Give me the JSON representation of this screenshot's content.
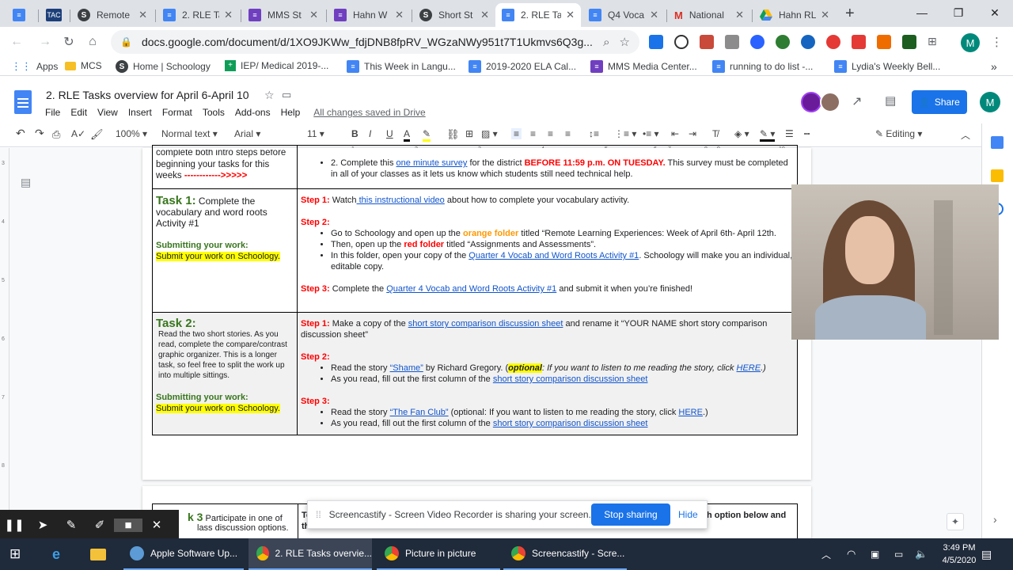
{
  "browser": {
    "tabs": [
      {
        "label": "",
        "icon": "docs-icon"
      },
      {
        "label": "",
        "icon": "tac-icon"
      },
      {
        "label": "Remote",
        "icon": "schoology-icon"
      },
      {
        "label": "2. RLE Ta",
        "icon": "docs-icon"
      },
      {
        "label": "MMS St",
        "icon": "forms-icon"
      },
      {
        "label": "Hahn W",
        "icon": "forms-icon"
      },
      {
        "label": "Short St",
        "icon": "schoology-icon"
      },
      {
        "label": "2. RLE Ta",
        "icon": "docs-icon",
        "active": true
      },
      {
        "label": "Q4 Voca",
        "icon": "docs-icon"
      },
      {
        "label": "National",
        "icon": "gmail-icon"
      },
      {
        "label": "Hahn RL",
        "icon": "drive-icon"
      }
    ],
    "tac_label": "TAC",
    "url": "docs.google.com/document/d/1XO9JKWw_fdjDNB8fpRV_WGzaNWy951t7T1Ukmvs6Q3g...",
    "profile_initial": "M",
    "bookmarks": [
      {
        "label": "Apps"
      },
      {
        "label": "MCS"
      },
      {
        "label": "Home | Schoology"
      },
      {
        "label": "IEP/ Medical 2019-..."
      },
      {
        "label": "This Week in Langu..."
      },
      {
        "label": "2019-2020 ELA Cal..."
      },
      {
        "label": "MMS Media Center..."
      },
      {
        "label": "running to do list -..."
      },
      {
        "label": "Lydia's Weekly Bell..."
      }
    ]
  },
  "docs": {
    "title": "2. RLE Tasks overview for April 6-April 10",
    "menus": [
      "File",
      "Edit",
      "View",
      "Insert",
      "Format",
      "Tools",
      "Add-ons",
      "Help"
    ],
    "saved_status": "All changes saved in Drive",
    "share_label": "Share",
    "toolbar": {
      "zoom": "100%",
      "style": "Normal text",
      "font": "Arial",
      "size": "11",
      "mode": "Editing"
    },
    "ruler_numbers": [
      "1",
      "2",
      "3",
      "4",
      "5",
      "6",
      "7",
      "8",
      "9",
      "10"
    ]
  },
  "content": {
    "row0_left_l1": "complete both intro steps before",
    "row0_left_l2": "beginning your tasks for this",
    "row0_left_l3": "weeks",
    "row0_arrow": "------------>>>>>",
    "row0_right_pre": "2. Complete this ",
    "row0_right_link": "one minute survey",
    "row0_right_mid": " for the district ",
    "row0_right_red": "BEFORE 11:59 p.m. ON TUESDAY.",
    "row0_right_post": "  This survey must be completed in all of your classes as it lets us know which students still need technical help.",
    "task1_title": "Task 1:",
    "task1_desc": " Complete the vocabulary and word roots Activity #1",
    "task1_sub": "Submitting your work:",
    "task1_sub_text": "Submit your work on Schoology.",
    "t1_s1_label": "Step 1:",
    "t1_s1_pre": " Watch",
    "t1_s1_link": " this instructional video",
    "t1_s1_post": " about how to complete your vocabulary activity.",
    "t1_s2_label": "Step 2:",
    "t1_b1_pre": " Go to Schoology and open up the ",
    "t1_b1_orange": "orange folder",
    "t1_b1_post": " titled “Remote Learning Experiences: Week of April 6th- April 12th.",
    "t1_b2_pre": "Then, open up the ",
    "t1_b2_red": "red folder",
    "t1_b2_post": " titled “Assignments and Assessments”.",
    "t1_b3_pre": "In this folder, open your copy of the ",
    "t1_b3_link": "Quarter 4 Vocab and Word Roots Activity #1",
    "t1_b3_post": ". Schoology will make you an individual, editable copy.",
    "t1_s3_label": "Step 3:",
    "t1_s3_pre": " Complete the  ",
    "t1_s3_link": "Quarter 4 Vocab and Word Roots Activity #1",
    "t1_s3_post": " and submit it when you’re finished!",
    "task2_title": "Task 2:",
    "task2_desc": "Read the two short stories. As you read, complete the compare/contrast graphic organizer. This is a longer task, so feel free to split the work up into multiple sittings.",
    "task2_sub": "Submitting your work:",
    "task2_sub_text": "Submit your work on Schoology.",
    "t2_s1_label": "Step 1:",
    "t2_s1_pre": " Make a copy of the  ",
    "t2_s1_link": "short story comparison discussion sheet",
    "t2_s1_post": " and rename it “YOUR NAME short story comparison discussion sheet”",
    "t2_s2_label": "Step 2:",
    "t2_b1_pre": "Read the story  ",
    "t2_b1_link": "“Shame”",
    "t2_b1_mid": " by Richard Gregory. (",
    "t2_b1_opt": "optional",
    "t2_b1_italic": ": If you want to listen to me reading the story, click ",
    "t2_b1_here": "HERE",
    "t2_b1_end": ".)",
    "t2_b2_pre": " As you read, fill out the first column of the ",
    "t2_b2_link": "short story comparison discussion sheet",
    "t2_s3_label": "Step 3:",
    "t2_b3_pre": "Read the story  ",
    "t2_b3_link": "“The Fan Club”",
    "t2_b3_mid": "  (optional: If you want to listen to me reading the story, click ",
    "t2_b3_here": "HERE",
    "t2_b3_end": ".)",
    "t2_b4_pre": " As you read, fill out the first column of the ",
    "t2_b4_link": "short story comparison discussion sheet",
    "task3_title": "k 3",
    "task3_desc": " Participate in one of",
    "task3_desc2": "lass discussion options.",
    "task3_right_a": "To",
    "task3_right_b": "h option below and",
    "task3_right_c": "th"
  },
  "screencastify": {
    "message": "Screencastify - Screen Video Recorder is sharing your screen.",
    "stop_label": "Stop sharing",
    "hide_label": "Hide"
  },
  "taskbar": {
    "items": [
      {
        "label": "Apple Software Up..."
      },
      {
        "label": "2. RLE Tasks overvie..."
      },
      {
        "label": "Picture in picture"
      },
      {
        "label": "Screencastify - Scre..."
      }
    ],
    "time": "3:49 PM",
    "date": "4/5/2020"
  },
  "colors": {
    "accent": "#1a73e8",
    "task_green": "#38761d",
    "highlight": "#ffff00",
    "link": "#1155cc"
  }
}
